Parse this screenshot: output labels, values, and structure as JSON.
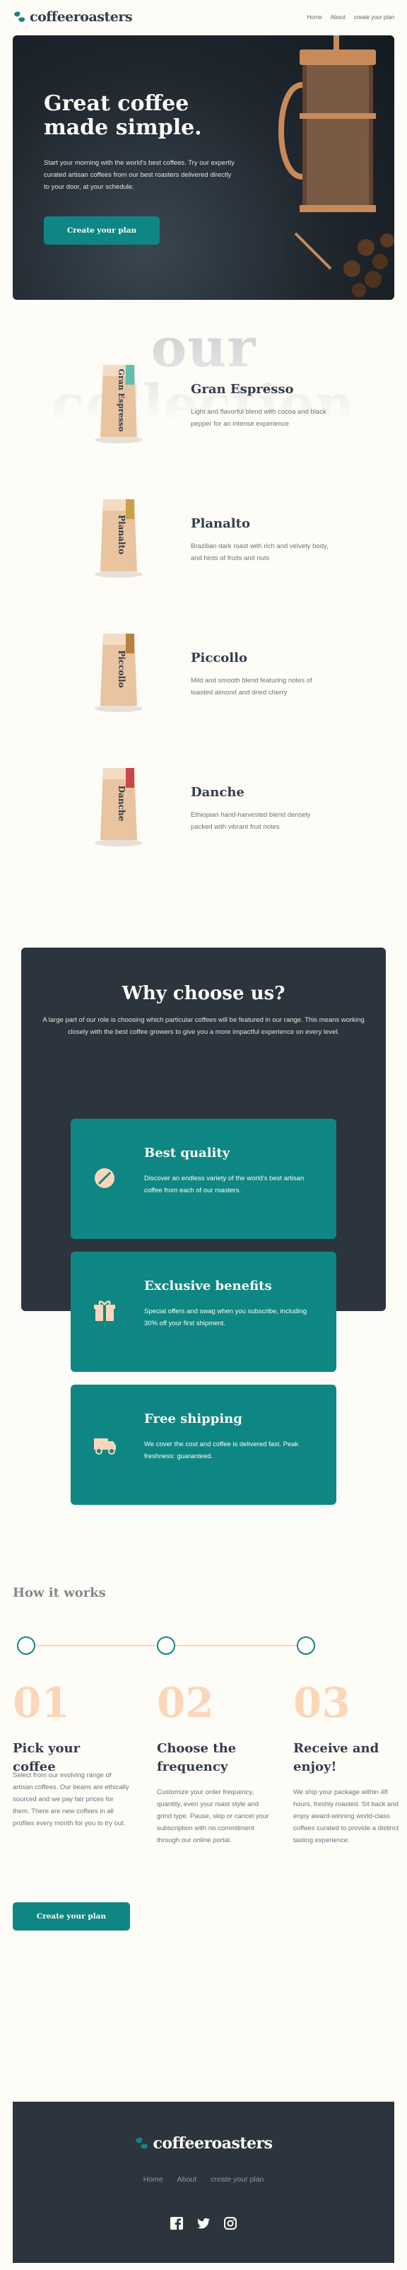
{
  "brand": {
    "name": "coffeeroasters"
  },
  "nav": {
    "home": "Home",
    "about": "About",
    "plan": "create your plan"
  },
  "hero": {
    "title": "Great coffee made simple.",
    "text": "Start your morning with the world's best coffees. Try our expertly curated artisan coffees from our best roasters delivered directly to your door, at your schedule.",
    "cta": "Create your plan"
  },
  "collection": {
    "title": "our collection",
    "items": [
      {
        "name": "Gran Espresso",
        "desc": "Light and flavorful blend with cocoa and black pepper for an intense experience",
        "bag_label": "Gran Espresso",
        "accent": "#5ebfb2"
      },
      {
        "name": "Planalto",
        "desc": "Brazilian dark roast with rich and velvety body, and hints of fruits and nuts",
        "bag_label": "Planalto",
        "accent": "#c8a04a"
      },
      {
        "name": "Piccollo",
        "desc": "Mild and smooth blend featuring notes of toasted almond and dried cherry",
        "bag_label": "Piccollo",
        "accent": "#b98040"
      },
      {
        "name": "Danche",
        "desc": "Ethiopian hand-harvested blend densely packed with vibrant fruit notes",
        "bag_label": "Danche",
        "accent": "#c8484a"
      }
    ]
  },
  "why": {
    "title": "Why choose us?",
    "text": "A large part of our role is choosing which particular coffees will be featured in our range. This means working closely with the best coffee growers to give you a more impactful experience on every level.",
    "features": [
      {
        "title": "Best quality",
        "text": "Discover an endless variety of the world's best artisan coffee from each of our roasters.",
        "icon": "coffee-bean-icon"
      },
      {
        "title": "Exclusive benefits",
        "text": "Special offers and swag when you subscribe, including 30% off your first shipment.",
        "icon": "gift-icon"
      },
      {
        "title": "Free shipping",
        "text": "We cover the cost and coffee is delivered fast. Peak freshness: guaranteed.",
        "icon": "truck-icon"
      }
    ]
  },
  "how": {
    "title": "How it works",
    "steps": [
      {
        "num": "01",
        "title": "Pick your coffee",
        "text": "Select from our evolving range of artisan coffees. Our beans are ethically sourced and we pay fair prices for them. There are new coffees in all profiles every month for you to try out."
      },
      {
        "num": "02",
        "title": "Choose the frequency",
        "text": "Customize your order frequency, quantity, even your roast style and grind type. Pause, skip or cancel your subscription with no commitment through our online portal."
      },
      {
        "num": "03",
        "title": "Receive and enjoy!",
        "text": "We ship your package within 48 hours, freshly roasted. Sit back and enjoy award-winning world-class coffees curated to provide a distinct tasting experience."
      }
    ],
    "cta": "Create your plan"
  },
  "footer": {
    "brand": "coffeeroasters",
    "nav": {
      "home": "Home",
      "about": "About",
      "plan": "create your plan"
    },
    "social": [
      "facebook-icon",
      "twitter-icon",
      "instagram-icon"
    ]
  },
  "colors": {
    "teal": "#0e8784",
    "dark": "#2c343e",
    "cream": "#fefcf7",
    "peach": "#fdd6ba"
  }
}
